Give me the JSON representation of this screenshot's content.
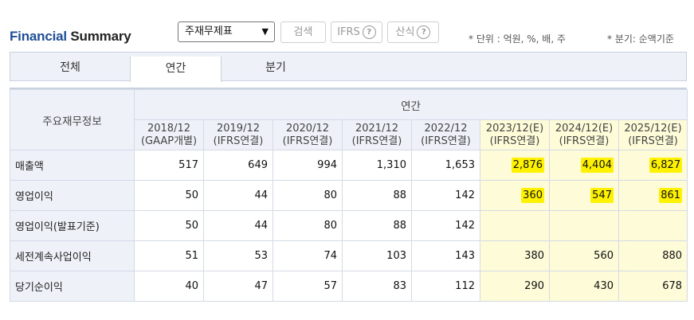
{
  "header": {
    "title_part1": "Financial",
    "title_part2": "Summary",
    "select_value": "주재무제표",
    "search_label": "검색",
    "ifrs_label": "IFRS",
    "formula_label": "산식",
    "unit_note": "* 단위 : 억원, %, 배, 주",
    "quarter_note": "* 분기: 순액기준"
  },
  "tabs": [
    "전체",
    "연간",
    "분기"
  ],
  "active_tab": "연간",
  "table": {
    "row_header": "주요재무정보",
    "group_header": "연간",
    "columns": [
      {
        "period": "2018/12",
        "basis": "(GAAP개별)",
        "estimate": false
      },
      {
        "period": "2019/12",
        "basis": "(IFRS연결)",
        "estimate": false
      },
      {
        "period": "2020/12",
        "basis": "(IFRS연결)",
        "estimate": false
      },
      {
        "period": "2021/12",
        "basis": "(IFRS연결)",
        "estimate": false
      },
      {
        "period": "2022/12",
        "basis": "(IFRS연결)",
        "estimate": false
      },
      {
        "period": "2023/12(E)",
        "basis": "(IFRS연결)",
        "estimate": true
      },
      {
        "period": "2024/12(E)",
        "basis": "(IFRS연결)",
        "estimate": true
      },
      {
        "period": "2025/12(E)",
        "basis": "(IFRS연결)",
        "estimate": true
      }
    ],
    "rows": [
      {
        "label": "매출액",
        "values": [
          "517",
          "649",
          "994",
          "1,310",
          "1,653",
          "2,876",
          "4,404",
          "6,827"
        ]
      },
      {
        "label": "영업이익",
        "values": [
          "50",
          "44",
          "80",
          "88",
          "142",
          "360",
          "547",
          "861"
        ]
      },
      {
        "label": "영업이익(발표기준)",
        "values": [
          "50",
          "44",
          "80",
          "88",
          "142",
          "",
          "",
          ""
        ]
      },
      {
        "label": "세전계속사업이익",
        "values": [
          "51",
          "53",
          "74",
          "103",
          "143",
          "380",
          "560",
          "880"
        ]
      },
      {
        "label": "당기순이익",
        "values": [
          "40",
          "47",
          "57",
          "83",
          "112",
          "290",
          "430",
          "678"
        ]
      }
    ],
    "highlight_color": "#fff200"
  }
}
